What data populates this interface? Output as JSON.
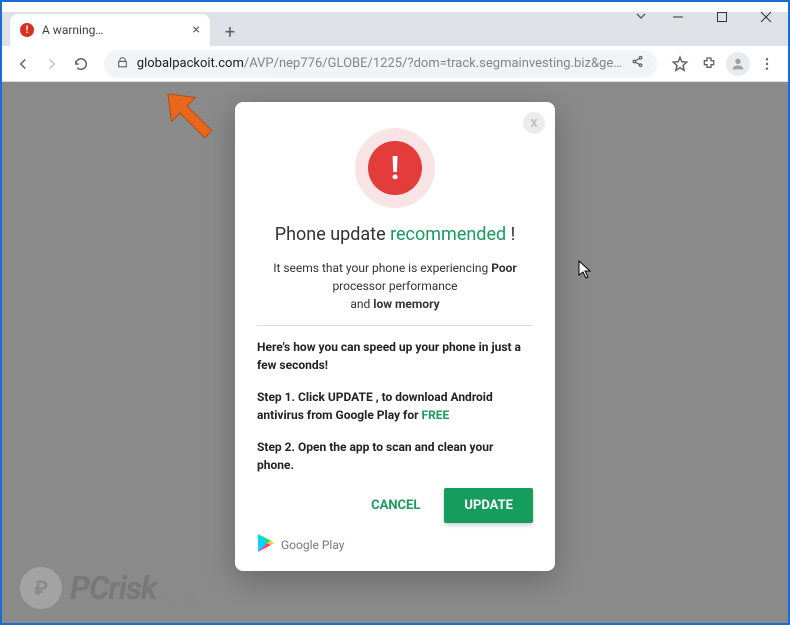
{
  "window": {
    "tab_title": "A warning…",
    "new_tab": "+",
    "close": "×",
    "url_domain": "globalpackoit.com",
    "url_path": "/AVP/nep776/GLOBE/1225/?dom=track.segmainvesting.biz&ge…"
  },
  "modal": {
    "close_label": "X",
    "alert_glyph": "!",
    "headline_a": "Phone update ",
    "headline_b": "recommended",
    "headline_c": " !",
    "sub_a": "It seems that your phone is experiencing ",
    "sub_b": "Poor",
    "sub_c": " processor performance",
    "sub_d": "and ",
    "sub_e": "low memory",
    "instr": "Here's how you can speed up your phone in just a few seconds!",
    "step1_a": "Step 1. Click UPDATE , to download Android antivirus from Google Play for ",
    "step1_b": "FREE",
    "step2": "Step 2. Open the app to scan and clean your phone.",
    "cancel": "CANCEL",
    "update": "UPDATE",
    "gplay": "Google Play"
  },
  "watermark": {
    "ring": "₽",
    "text": "PCrisk",
    "suffix": ".com"
  }
}
